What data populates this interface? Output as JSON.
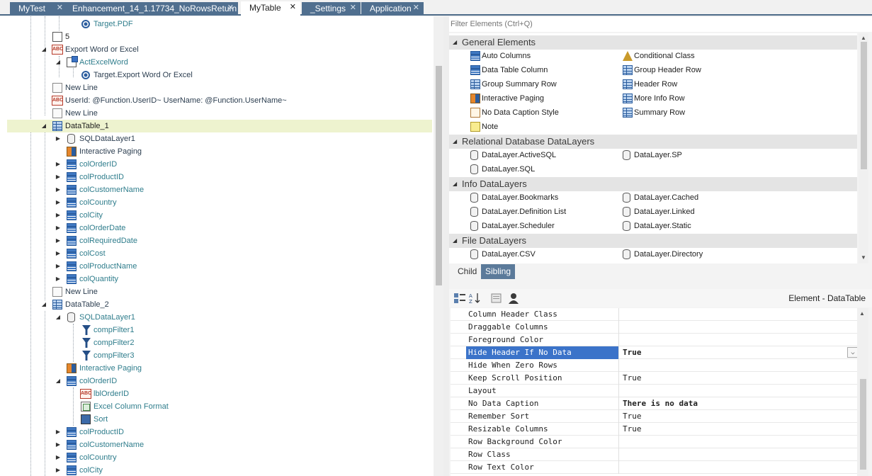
{
  "tabs": [
    {
      "label": "MyTest",
      "close": "✕",
      "active": false
    },
    {
      "label": "Enhancement_14_1.17734_NoRowsReturn",
      "close": "✕",
      "active": false
    },
    {
      "label": "MyTable",
      "close": "✕",
      "active": true
    },
    {
      "label": "_Settings",
      "close": "✕",
      "active": false
    },
    {
      "label": "Application",
      "close": "✕",
      "active": false
    }
  ],
  "tree": {
    "rows": [
      {
        "label": "Target.PDF",
        "icon": "target-icon"
      },
      {
        "label": "5",
        "icon": "numeric-icon"
      },
      {
        "label": "Export Word or Excel",
        "icon": "label-icon"
      },
      {
        "label": "ActExcelWord",
        "icon": "action-icon"
      },
      {
        "label": "Target.Export Word Or Excel",
        "icon": "target-icon"
      },
      {
        "label": "New Line",
        "icon": "new-line-icon"
      },
      {
        "label": "UserId: @Function.UserID~ UserName: @Function.UserName~",
        "icon": "label-icon"
      },
      {
        "label": "New Line",
        "icon": "new-line-icon"
      },
      {
        "label": "DataTable_1",
        "icon": "data-table-icon"
      },
      {
        "label": "SQLDataLayer1",
        "icon": "datalayer-icon"
      },
      {
        "label": "Interactive Paging",
        "icon": "interactive-paging-icon"
      },
      {
        "label": "colOrderID",
        "icon": "column-icon"
      },
      {
        "label": "colProductID",
        "icon": "column-icon"
      },
      {
        "label": "colCustomerName",
        "icon": "column-icon"
      },
      {
        "label": "colCountry",
        "icon": "column-icon"
      },
      {
        "label": "colCity",
        "icon": "column-icon"
      },
      {
        "label": "colOrderDate",
        "icon": "column-icon"
      },
      {
        "label": "colRequiredDate",
        "icon": "column-icon"
      },
      {
        "label": "colCost",
        "icon": "column-icon"
      },
      {
        "label": "colProductName",
        "icon": "column-icon"
      },
      {
        "label": "colQuantity",
        "icon": "column-icon"
      },
      {
        "label": "New Line",
        "icon": "new-line-icon"
      },
      {
        "label": "DataTable_2",
        "icon": "data-table-icon"
      },
      {
        "label": "SQLDataLayer1",
        "icon": "datalayer-icon"
      },
      {
        "label": "compFilter1",
        "icon": "filter-icon"
      },
      {
        "label": "compFilter2",
        "icon": "filter-icon"
      },
      {
        "label": "compFilter3",
        "icon": "filter-icon"
      },
      {
        "label": "Interactive Paging",
        "icon": "interactive-paging-icon"
      },
      {
        "label": "colOrderID",
        "icon": "column-icon"
      },
      {
        "label": "lblOrderID",
        "icon": "label-icon"
      },
      {
        "label": "Excel Column Format",
        "icon": "excel-format-icon"
      },
      {
        "label": "Sort",
        "icon": "sort-icon"
      },
      {
        "label": "colProductID",
        "icon": "column-icon"
      },
      {
        "label": "colCustomerName",
        "icon": "column-icon"
      },
      {
        "label": "colCountry",
        "icon": "column-icon"
      },
      {
        "label": "colCity",
        "icon": "column-icon"
      }
    ]
  },
  "elements_panel": {
    "filter_placeholder": "Filter Elements (Ctrl+Q)",
    "sections": [
      {
        "title": "General Elements",
        "items": [
          {
            "label": "Auto Columns",
            "icon": "auto-columns-icon"
          },
          {
            "label": "Conditional Class",
            "icon": "conditional-class-icon"
          },
          {
            "label": "Data Table Column",
            "icon": "column-icon"
          },
          {
            "label": "Group Header Row",
            "icon": "row-icon"
          },
          {
            "label": "Group Summary Row",
            "icon": "row-icon"
          },
          {
            "label": "Header Row",
            "icon": "row-icon"
          },
          {
            "label": "Interactive Paging",
            "icon": "interactive-paging-icon"
          },
          {
            "label": "More Info Row",
            "icon": "row-icon"
          },
          {
            "label": "No Data Caption Style",
            "icon": "caption-style-icon"
          },
          {
            "label": "Summary Row",
            "icon": "row-icon"
          },
          {
            "label": "Note",
            "icon": "note-icon"
          }
        ]
      },
      {
        "title": "Relational Database DataLayers",
        "items": [
          {
            "label": "DataLayer.ActiveSQL",
            "icon": "datalayer-icon"
          },
          {
            "label": "DataLayer.SP",
            "icon": "datalayer-icon"
          },
          {
            "label": "DataLayer.SQL",
            "icon": "datalayer-icon"
          }
        ]
      },
      {
        "title": "Info DataLayers",
        "items": [
          {
            "label": "DataLayer.Bookmarks",
            "icon": "datalayer-icon"
          },
          {
            "label": "DataLayer.Cached",
            "icon": "datalayer-icon"
          },
          {
            "label": "DataLayer.Definition List",
            "icon": "datalayer-icon"
          },
          {
            "label": "DataLayer.Linked",
            "icon": "datalayer-icon"
          },
          {
            "label": "DataLayer.Scheduler",
            "icon": "datalayer-icon"
          },
          {
            "label": "DataLayer.Static",
            "icon": "datalayer-icon"
          }
        ]
      },
      {
        "title": "File DataLayers",
        "items": [
          {
            "label": "DataLayer.CSV",
            "icon": "datalayer-icon"
          },
          {
            "label": "DataLayer.Directory",
            "icon": "datalayer-icon"
          }
        ]
      }
    ],
    "child_tab": "Child",
    "sibling_tab": "Sibling"
  },
  "properties": {
    "title": "Element - DataTable",
    "rows": [
      {
        "name": "Column Header Class",
        "value": ""
      },
      {
        "name": "Draggable Columns",
        "value": ""
      },
      {
        "name": "Foreground Color",
        "value": ""
      },
      {
        "name": "Hide Header If No Data",
        "value": "True"
      },
      {
        "name": "Hide When Zero Rows",
        "value": ""
      },
      {
        "name": "Keep Scroll Position",
        "value": "True"
      },
      {
        "name": "Layout",
        "value": ""
      },
      {
        "name": "No Data Caption",
        "value": "There is no data"
      },
      {
        "name": "Remember Sort",
        "value": "True"
      },
      {
        "name": "Resizable Columns",
        "value": "True"
      },
      {
        "name": "Row Background Color",
        "value": ""
      },
      {
        "name": "Row Class",
        "value": ""
      },
      {
        "name": "Row Text Color",
        "value": ""
      }
    ]
  },
  "colors": {
    "tab_inactive": "#506f8f",
    "selection_highlight": "#eef3cf",
    "property_selected": "#3b73c9",
    "sibling_tab_active": "#5b7a9a"
  }
}
